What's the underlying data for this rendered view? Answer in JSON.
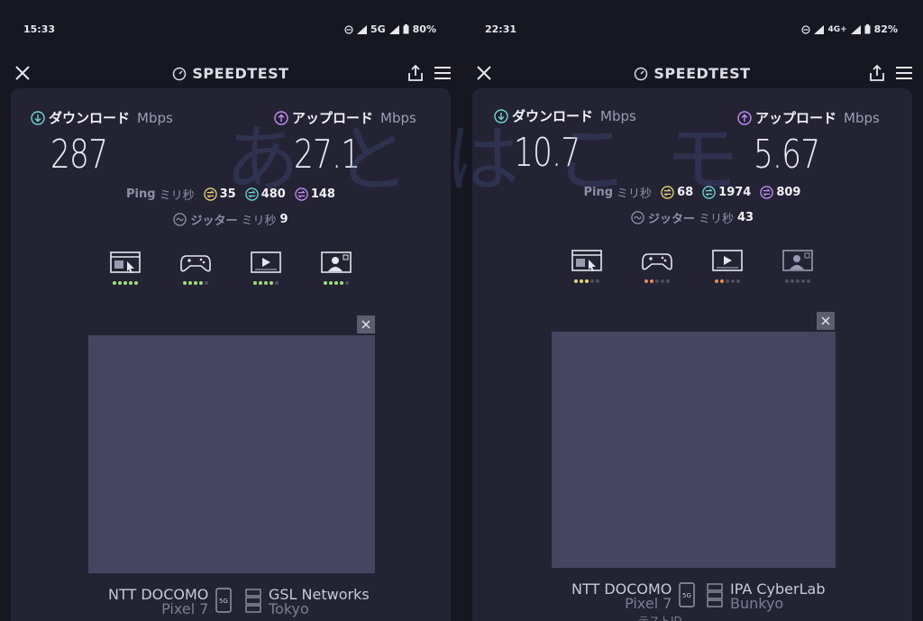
{
  "left": {
    "status": {
      "time": "15:33",
      "network": "5G",
      "battery": "80%"
    },
    "app": {
      "title": "SPEEDTEST"
    },
    "download": {
      "label": "ダウンロード",
      "unit": "Mbps",
      "value": "287"
    },
    "upload": {
      "label": "アップロード",
      "unit": "Mbps",
      "value": "27.1"
    },
    "ping": {
      "label": "Ping",
      "unit": "ミリ秒",
      "idle": "35",
      "download": "480",
      "upload": "148"
    },
    "jitter": {
      "label": "ジッター",
      "unit": "ミリ秒",
      "value": "9"
    },
    "footer": {
      "carrier": "NTT DOCOMO",
      "device": "Pixel 7",
      "server": "GSL Networks",
      "location": "Tokyo",
      "badge": "5G"
    }
  },
  "right": {
    "status": {
      "time": "22:31",
      "network": "4G+",
      "battery": "82%"
    },
    "app": {
      "title": "SPEEDTEST"
    },
    "download": {
      "label": "ダウンロード",
      "unit": "Mbps",
      "value": "10.7"
    },
    "upload": {
      "label": "アップロード",
      "unit": "Mbps",
      "value": "5.67"
    },
    "ping": {
      "label": "Ping",
      "unit": "ミリ秒",
      "idle": "68",
      "download": "1974",
      "upload": "809"
    },
    "jitter": {
      "label": "ジッター",
      "unit": "ミリ秒",
      "value": "43"
    },
    "footer": {
      "carrier": "NTT DOCOMO",
      "device": "Pixel 7",
      "server": "IPA CyberLab",
      "location": "Bunkyo",
      "badge": "5G",
      "extra": "テストID"
    }
  },
  "watermark": "あとはこモ",
  "quality": {
    "icons": [
      "browsing-icon",
      "gaming-icon",
      "video-icon",
      "video-call-icon"
    ],
    "left_levels": [
      5,
      4,
      4,
      4
    ],
    "right_levels": [
      3,
      2,
      2,
      0
    ],
    "right_level_colors": [
      "#e8d27a",
      "#e88a5a",
      "#e88a5a",
      "#4d4d60"
    ]
  },
  "colors": {
    "download_accent": "#6fd6d0",
    "upload_accent": "#c58cf5",
    "ping_idle": "#e8d27a",
    "good_dot": "#9fe07a",
    "background": "#171722",
    "card": "#232334"
  }
}
